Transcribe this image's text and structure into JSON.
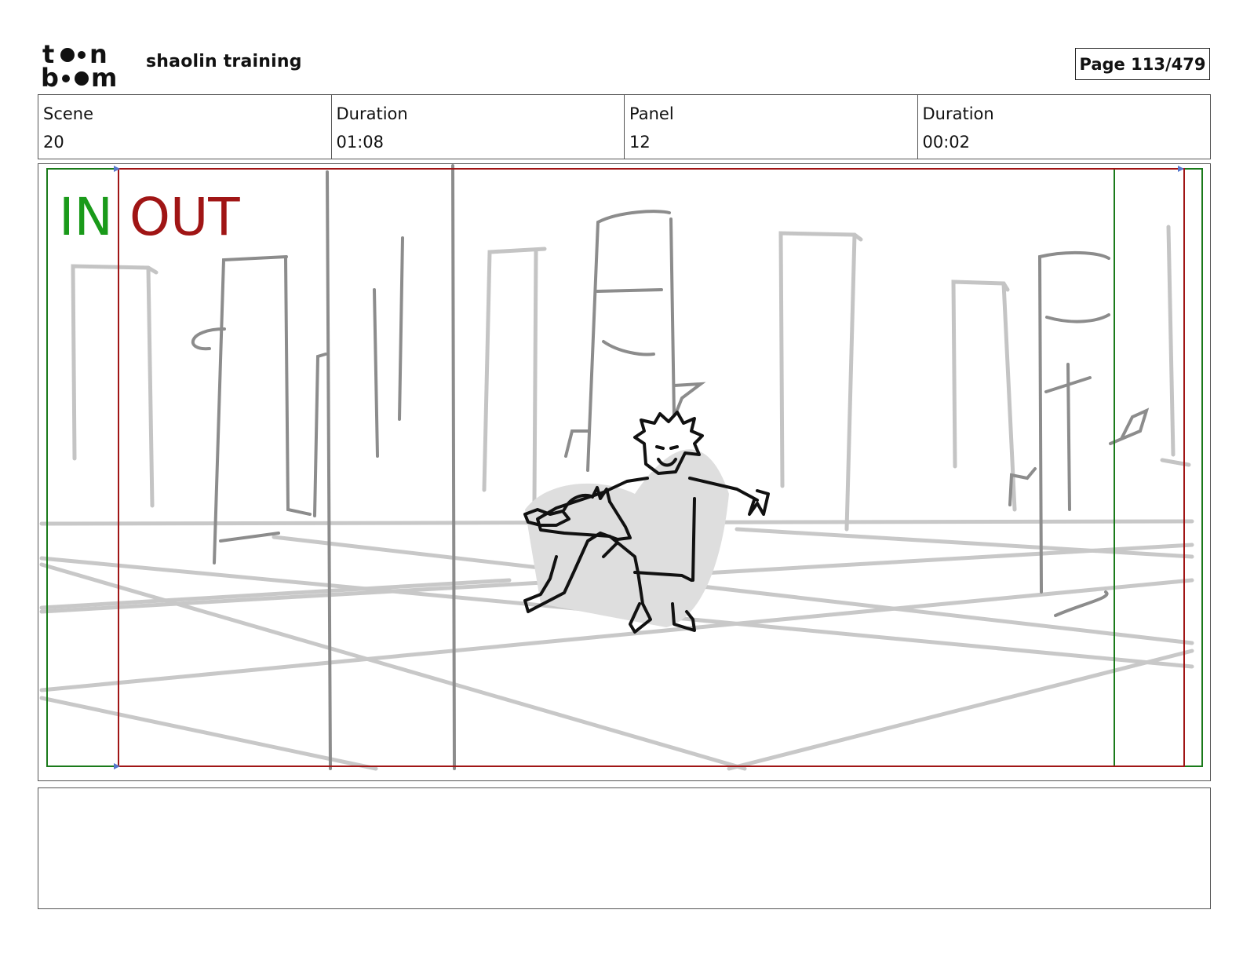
{
  "header": {
    "project_title": "shaolin training",
    "page_label": "Page 113/479"
  },
  "logo": {
    "text_line1": "toon",
    "text_line2": "boom"
  },
  "info": {
    "scene_label": "Scene",
    "scene_value": "20",
    "scene_duration_label": "Duration",
    "scene_duration_value": "01:08",
    "panel_label": "Panel",
    "panel_value": "12",
    "panel_duration_label": "Duration",
    "panel_duration_value": "00:02"
  },
  "panel": {
    "in_label": "IN",
    "out_label": "OUT",
    "in_color": "#1a9a1a",
    "out_color": "#a01515"
  },
  "notes": {
    "text": ""
  }
}
